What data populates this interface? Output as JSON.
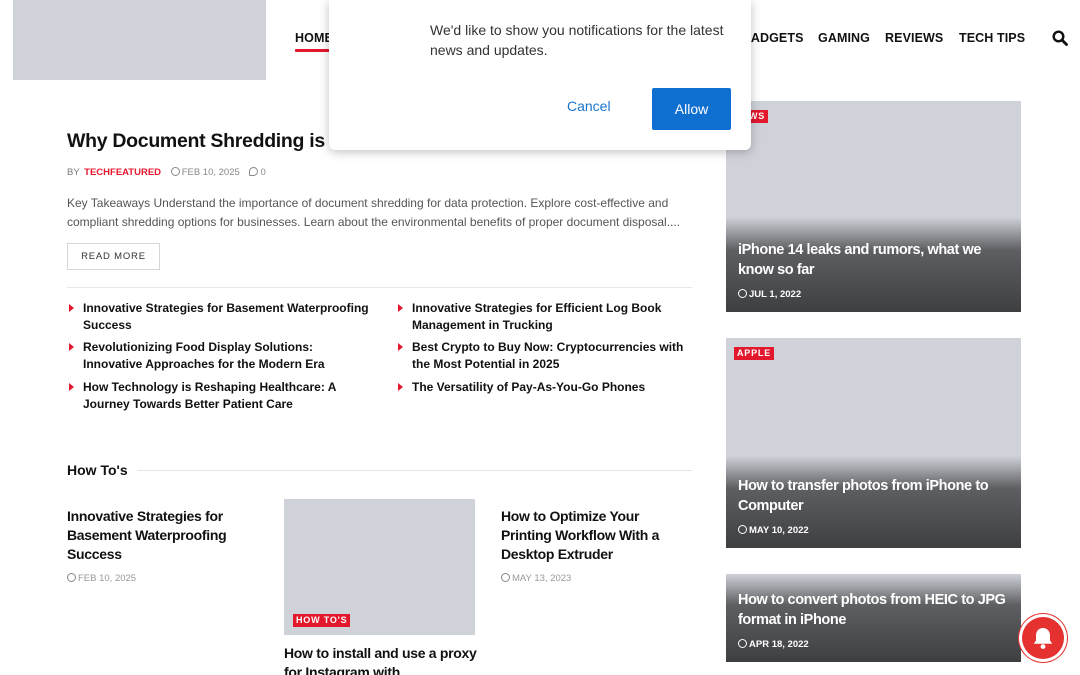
{
  "nav": {
    "items": [
      {
        "label": "HOME",
        "active": true
      },
      {
        "label": "GADGETS"
      },
      {
        "label": "GAMING"
      },
      {
        "label": "REVIEWS"
      },
      {
        "label": "TECH TIPS"
      }
    ],
    "icon": "search-icon"
  },
  "popup": {
    "message": "We'd like to show you notifications for the latest news and updates.",
    "cancel_label": "Cancel",
    "allow_label": "Allow"
  },
  "featured": {
    "title": "Why Document Shredding is Esse",
    "by": "BY",
    "author": "TECHFEATURED",
    "date": "FEB 10, 2025",
    "comments": "0",
    "excerpt": "Key Takeaways Understand the importance of document shredding for data protection. Explore cost-effective and compliant shredding options for businesses. Learn about the environmental benefits of proper document disposal....",
    "read_more": "READ MORE"
  },
  "related": [
    "Innovative Strategies for Basement Waterproofing Success",
    "Innovative Strategies for Efficient Log Book Management in Trucking",
    "Revolutionizing Food Display Solutions: Innovative Approaches for the Modern Era",
    "Best Crypto to Buy Now: Cryptocurrencies with the Most Potential in 2025",
    "How Technology is Reshaping Healthcare: A Journey Towards Better Patient Care",
    "The Versatility of Pay-As-You-Go Phones"
  ],
  "howtos": {
    "section_title": "How To's",
    "cards": [
      {
        "title": "Innovative Strategies for Basement Waterproofing Success",
        "date": "FEB 10, 2025"
      },
      {
        "title": "How to install and use a proxy for Instagram with OnlineProxy?",
        "tag": "HOW TO'S"
      },
      {
        "title": "How to Optimize Your Printing Workflow With a Desktop Extruder",
        "date": "MAY 13, 2023"
      }
    ]
  },
  "sidebar": [
    {
      "tag": "WS",
      "title": "iPhone 14 leaks and rumors, what we know so far",
      "date": "JUL 1, 2022"
    },
    {
      "tag": "APPLE",
      "title": "How to transfer photos from iPhone to Computer",
      "date": "MAY 10, 2022"
    },
    {
      "title": "How to convert photos from HEIC to JPG format in iPhone",
      "date": "APR 18, 2022"
    }
  ],
  "colors": {
    "accent": "#e3182d",
    "allow_button": "#0f6fd1",
    "placeholder": "#cfd2d9"
  }
}
